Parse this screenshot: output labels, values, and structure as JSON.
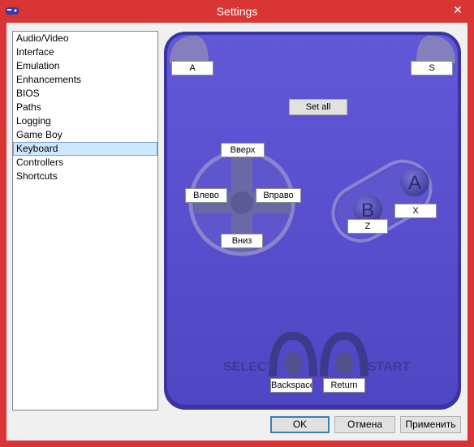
{
  "window": {
    "title": "Settings",
    "close_glyph": "✕"
  },
  "sidebar": {
    "items": [
      {
        "label": "Audio/Video"
      },
      {
        "label": "Interface"
      },
      {
        "label": "Emulation"
      },
      {
        "label": "Enhancements"
      },
      {
        "label": "BIOS"
      },
      {
        "label": "Paths"
      },
      {
        "label": "Logging"
      },
      {
        "label": "Game Boy"
      },
      {
        "label": "Keyboard",
        "selected": true
      },
      {
        "label": "Controllers"
      },
      {
        "label": "Shortcuts"
      }
    ]
  },
  "keyboard": {
    "l_key": "A",
    "r_key": "S",
    "set_all": "Set all",
    "up": "Вверх",
    "left": "Влево",
    "right": "Вправо",
    "down": "Вниз",
    "a_key": "X",
    "b_key": "Z",
    "select_key": "Backspace",
    "start_key": "Return",
    "select_text": "SELECT",
    "start_text": "START",
    "a_glyph": "A",
    "b_glyph": "B"
  },
  "buttons": {
    "ok": "OK",
    "cancel": "Отмена",
    "apply": "Применить"
  },
  "colors": {
    "titlebar": "#d93535",
    "pad_body": "#5b4fcf",
    "pad_border": "#3a33a0",
    "pad_dark": "#3d3a8c"
  }
}
